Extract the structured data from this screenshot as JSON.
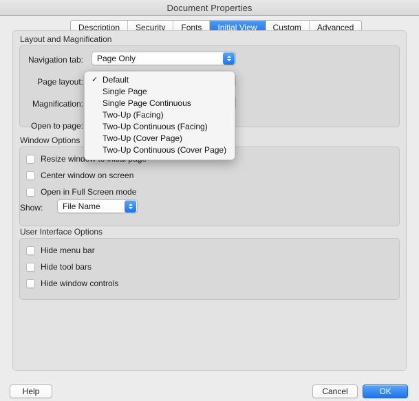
{
  "window": {
    "title": "Document Properties"
  },
  "tabs": [
    {
      "label": "Description",
      "active": false
    },
    {
      "label": "Security",
      "active": false
    },
    {
      "label": "Fonts",
      "active": false
    },
    {
      "label": "Initial View",
      "active": true
    },
    {
      "label": "Custom",
      "active": false
    },
    {
      "label": "Advanced",
      "active": false
    }
  ],
  "sections": {
    "layout": {
      "title": "Layout and Magnification",
      "fields": [
        {
          "label": "Navigation tab:",
          "value": "Page Only"
        },
        {
          "label": "Page layout:",
          "value": ""
        },
        {
          "label": "Magnification:",
          "value": ""
        },
        {
          "label": "Open to page:",
          "value": ""
        }
      ]
    },
    "window_options": {
      "title": "Window Options",
      "checkboxes": [
        {
          "label": "Resize window to initial page",
          "checked": false
        },
        {
          "label": "Center window on screen",
          "checked": false
        },
        {
          "label": "Open in Full Screen mode",
          "checked": false
        }
      ],
      "show_label": "Show:",
      "show_value": "File Name"
    },
    "ui_options": {
      "title": "User Interface Options",
      "checkboxes": [
        {
          "label": "Hide menu bar",
          "checked": false
        },
        {
          "label": "Hide tool bars",
          "checked": false
        },
        {
          "label": "Hide window controls",
          "checked": false
        }
      ]
    }
  },
  "open_menu": {
    "owner": "Page layout:",
    "checkmark": "✓",
    "items": [
      {
        "label": "Default",
        "selected": true
      },
      {
        "label": "Single Page",
        "selected": false
      },
      {
        "label": "Single Page Continuous",
        "selected": false
      },
      {
        "label": "Two-Up (Facing)",
        "selected": false
      },
      {
        "label": "Two-Up Continuous (Facing)",
        "selected": false
      },
      {
        "label": "Two-Up (Cover Page)",
        "selected": false
      },
      {
        "label": "Two-Up Continuous (Cover Page)",
        "selected": false
      }
    ]
  },
  "footer": {
    "help_label": "Help",
    "cancel_label": "Cancel",
    "ok_label": "OK"
  },
  "colors": {
    "accent_blue": "#1f74e9",
    "window_bg": "#ececec",
    "panel_bg": "#e3e3e3",
    "group_bg": "#d9d9d9"
  }
}
